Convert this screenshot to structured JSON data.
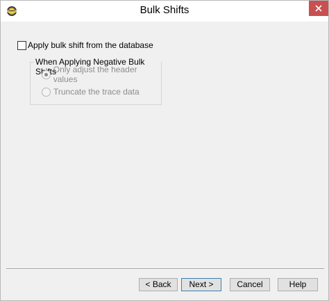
{
  "window": {
    "title": "Bulk Shifts",
    "app_icon": "globe-app-icon",
    "close_icon": "close-icon"
  },
  "options": {
    "apply_bulk_shift_label": "Apply bulk shift from the database",
    "apply_bulk_shift_checked": false
  },
  "negative_shifts_group": {
    "title": "When Applying Negative Bulk Shifts",
    "radios": [
      {
        "label": "Only adjust the header values",
        "selected": true,
        "enabled": false
      },
      {
        "label": "Truncate the trace data",
        "selected": false,
        "enabled": false
      }
    ]
  },
  "buttons": {
    "back": "< Back",
    "next": "Next >",
    "cancel": "Cancel",
    "help": "Help"
  },
  "colors": {
    "close_button": "#c75050",
    "default_button_border": "#3c7fb1",
    "disabled_text": "#8d8d8d"
  }
}
